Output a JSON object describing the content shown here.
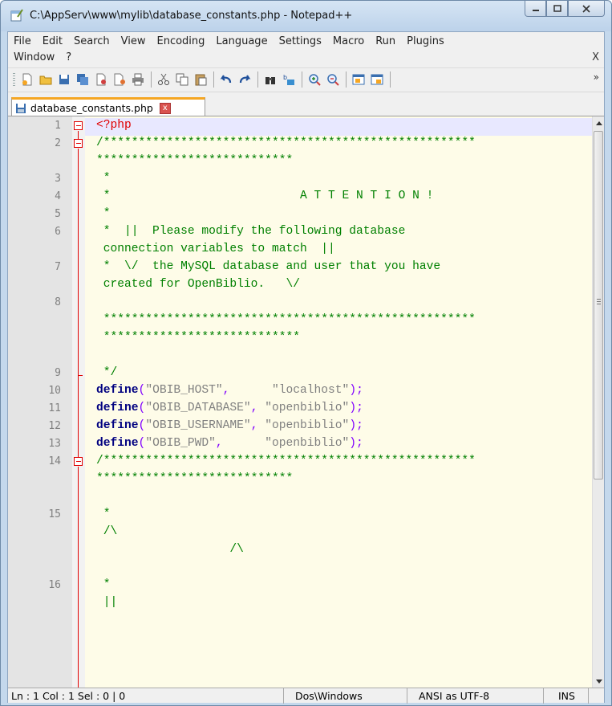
{
  "window": {
    "title": "C:\\AppServ\\www\\mylib\\database_constants.php - Notepad++"
  },
  "menu": {
    "row1": [
      "File",
      "Edit",
      "Search",
      "View",
      "Encoding",
      "Language",
      "Settings",
      "Macro",
      "Run",
      "Plugins"
    ],
    "row2": [
      "Window",
      "?"
    ],
    "close_label": "X"
  },
  "toolbar": {
    "more": "»"
  },
  "tab": {
    "label": "database_constants.php",
    "close": "x"
  },
  "editor": {
    "line_numbers": [
      "1",
      "2",
      "3",
      "4",
      "5",
      "6",
      "7",
      "8",
      "9",
      "10",
      "11",
      "12",
      "13",
      "14",
      "15",
      "16"
    ],
    "lines": {
      "l1": "<?php",
      "l2a": "/*****************************************************",
      "l2b": "****************************",
      "l3": " *",
      "l4": " *                           A T T E N T I O N !",
      "l5": " *",
      "l6a": " *  ||  Please modify the following database",
      "l6b": " connection variables to match  ||",
      "l7a": " *  \\/  the MySQL database and user that you have",
      "l7b": " created for OpenBiblio.   \\/",
      "l8a": " *****************************************************",
      "l8b": " ****************************",
      "l9": " */",
      "l10_kw": "define",
      "l10_name": "\"OBIB_HOST\"",
      "l10_val": "\"localhost\"",
      "l11_kw": "define",
      "l11_name": "\"OBIB_DATABASE\"",
      "l11_val": "\"openbiblio\"",
      "l12_kw": "define",
      "l12_name": "\"OBIB_USERNAME\"",
      "l12_val": "\"openbiblio\"",
      "l13_kw": "define",
      "l13_name": "\"OBIB_PWD\"",
      "l13_val": "\"openbiblio\"",
      "l14a": "/*****************************************************",
      "l14b": "****************************",
      "l15a": " *",
      "l15b": " /\\",
      "l15c": "                   /\\",
      "l16a": " *",
      "l16b": " ||"
    }
  },
  "status": {
    "position": "Ln : 1   Col : 1   Sel : 0 | 0",
    "eol": "Dos\\Windows",
    "encoding": "ANSI as UTF-8",
    "mode": "INS"
  },
  "colors": {
    "php_tag": "#e00000",
    "comment": "#008000",
    "keyword": "#000080",
    "string": "#808080",
    "operator": "#8000ff",
    "tab_accent": "#f5a623"
  }
}
